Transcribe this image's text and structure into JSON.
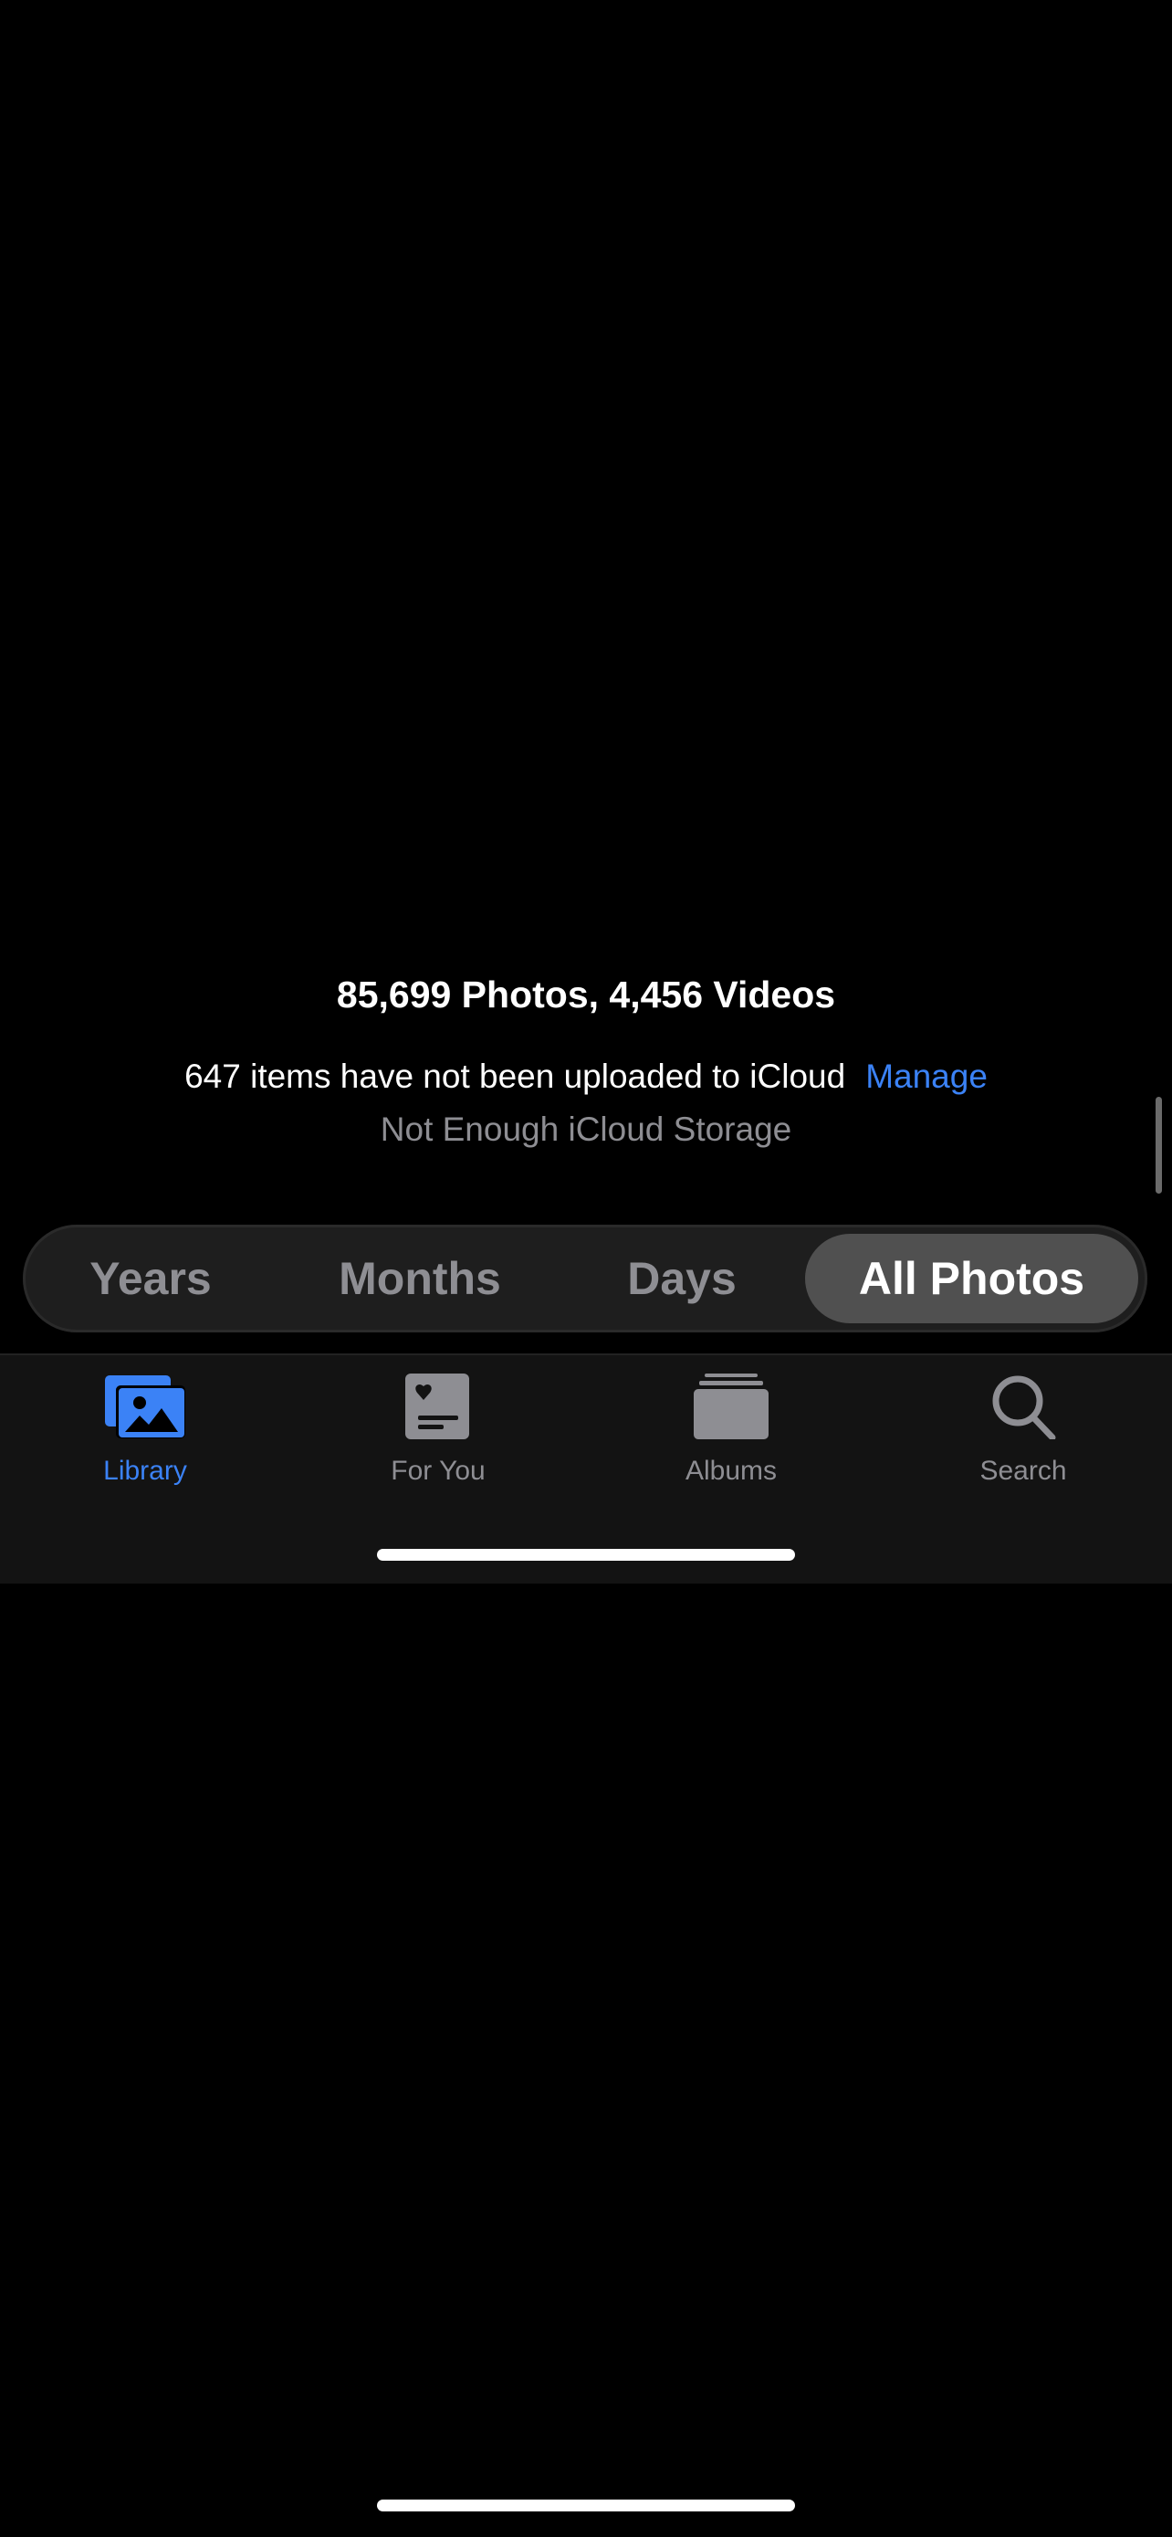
{
  "library_summary": {
    "counts": "85,699 Photos, 4,456 Videos",
    "upload_notice": "647 items have not been uploaded to iCloud",
    "manage_link": "Manage",
    "storage_status": "Not Enough iCloud Storage"
  },
  "view_switcher": {
    "options": [
      "Years",
      "Months",
      "Days",
      "All Photos"
    ],
    "selected": "All Photos"
  },
  "tab_bar": {
    "items": [
      {
        "label": "Library",
        "icon": "photo-library-icon",
        "active": true
      },
      {
        "label": "For You",
        "icon": "for-you-icon",
        "active": false
      },
      {
        "label": "Albums",
        "icon": "albums-icon",
        "active": false
      },
      {
        "label": "Search",
        "icon": "search-icon",
        "active": false
      }
    ]
  },
  "colors": {
    "accent": "#3b82f6",
    "secondary_text": "#8e8e93",
    "background": "#000000"
  }
}
